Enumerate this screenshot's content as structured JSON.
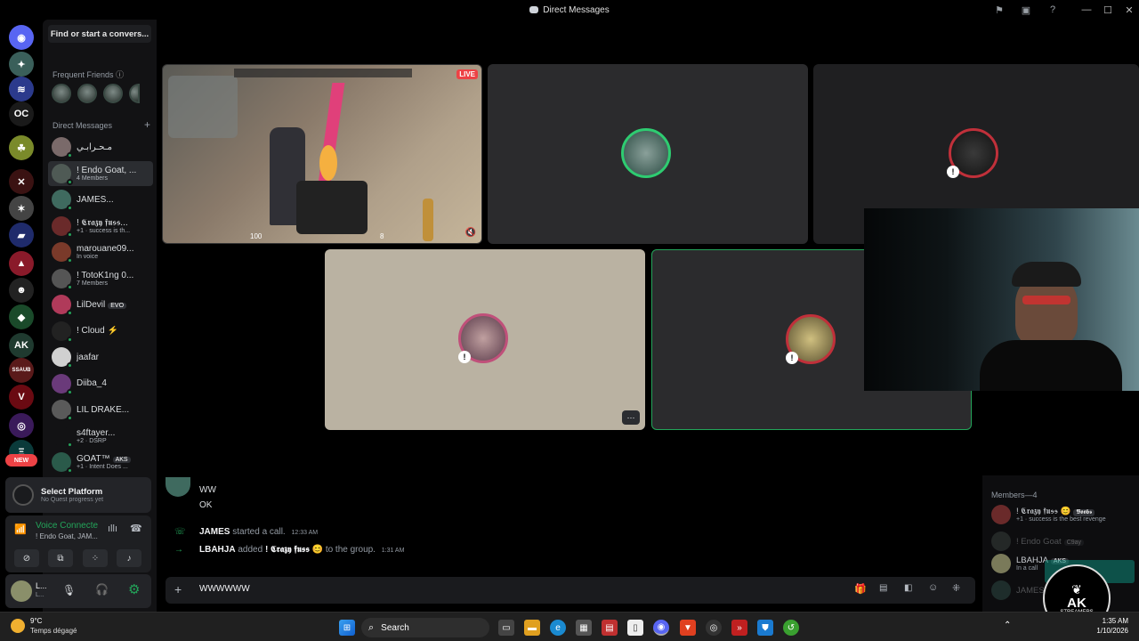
{
  "window": {
    "title": "Direct Messages"
  },
  "guilds": [
    {
      "color": "#5865f2",
      "glyph": "◉",
      "badge": "24"
    },
    {
      "color": "#3a5f5a",
      "glyph": "✦",
      "badge": ""
    },
    {
      "color": "#2b3a8c",
      "glyph": "≋",
      "badge": "1"
    },
    {
      "color": "#1a1a1a",
      "glyph": "OC",
      "badge": "1"
    },
    {
      "color": "#7a8a2a",
      "glyph": "☘",
      "badge": ""
    },
    {
      "color": "#3a1212",
      "glyph": "✕",
      "badge": "65"
    },
    {
      "color": "#444444",
      "glyph": "✶",
      "badge": "1"
    },
    {
      "color": "#1f2b6b",
      "glyph": "▰",
      "badge": "1"
    },
    {
      "color": "#8a1a2a",
      "glyph": "▲",
      "badge": "144"
    },
    {
      "color": "#222222",
      "glyph": "☻",
      "badge": "1"
    },
    {
      "color": "#1a4a2a",
      "glyph": "◆",
      "badge": "837"
    },
    {
      "color": "#1f3a2f",
      "glyph": "AK",
      "badge": "1"
    },
    {
      "color": "#5a1a1a",
      "glyph": "SSAUB",
      "badge": ""
    },
    {
      "color": "#6a0a12",
      "glyph": "V",
      "badge": ""
    },
    {
      "color": "#3a1a5a",
      "glyph": "◎",
      "badge": "88"
    },
    {
      "color": "#0a3a3a",
      "glyph": "Ξ",
      "badge": ""
    }
  ],
  "new_badge": "NEW",
  "sidebar": {
    "search_placeholder": "Find or start a convers...",
    "frequent_friends_label": "Frequent Friends",
    "direct_messages_label": "Direct Messages",
    "add_icon": "+",
    "dms": [
      {
        "name": "مـحـرابـي",
        "sub": "",
        "color": "#7a6a6a"
      },
      {
        "name": "! Endo Goat, ...",
        "sub": "4 Members",
        "color": "#4f5a55"
      },
      {
        "name": "JAMES...",
        "sub": "",
        "color": "#3f6a5f"
      },
      {
        "name": "! 𝕮𝖗𝖆𝖟𝖞 𝖋𝖚𝖘𝖘...",
        "sub": "+1 · success is th...",
        "color": "#6a2a2a"
      },
      {
        "name": "marouane09...",
        "sub": "In voice",
        "color": "#7a3a2a"
      },
      {
        "name": "! TotoK1ng 0...",
        "sub": "7 Members",
        "color": "#555555"
      },
      {
        "name": "LilDevil",
        "sub": "",
        "color": "#b03a5a",
        "tag": "EVO"
      },
      {
        "name": "! Cloud ⚡",
        "sub": "",
        "color": "#222222"
      },
      {
        "name": "jaafar",
        "sub": "",
        "color": "#d0d0d0"
      },
      {
        "name": "Diiba_4",
        "sub": "",
        "color": "#6a3a7a"
      },
      {
        "name": "LIL DRAKE...",
        "sub": "",
        "color": "#5a5a5a"
      },
      {
        "name": "s4ftayer...",
        "sub": "+2 · DSRP",
        "color": "#121214"
      },
      {
        "name": "GOAT™",
        "sub": "+1 · Intent Does ...",
        "color": "#2a5a4a",
        "tag": "AKS"
      }
    ]
  },
  "quest": {
    "title": "Select Platform",
    "subtitle": "No Quest progress yet"
  },
  "voice": {
    "status": "Voice Connecte",
    "channel": "! Endo Goat, JAM..."
  },
  "user": {
    "name": "L...",
    "sub": "L..."
  },
  "tiles": {
    "live_label": "LIVE",
    "stream_hp": "100",
    "stream_ammo": "8"
  },
  "chat": {
    "messages": [
      {
        "author": "JAMES",
        "time": "12:33 AM",
        "lines": [
          "WW",
          "OK"
        ]
      },
      {
        "author": "JAMES",
        "text": "started a call.",
        "time": "12:33 AM"
      },
      {
        "author": "LBAHJA",
        "text_before": "added",
        "target": "! 𝕮𝖗𝖆𝖟𝖞 𝖋𝖚𝖘𝖘 😊",
        "text_after": "to the group.",
        "time": "1:31 AM"
      }
    ],
    "composer_value": "WWWWWW"
  },
  "members": {
    "header": "Members—4",
    "list": [
      {
        "name": "! 𝕮𝖗𝖆𝖟𝖞 𝖋𝖚𝖘𝖘 😊",
        "tag": "𝕭𝖔𝖔𝖇𝖘",
        "sub": "+1 · success is the best revenge",
        "color": "#6a2a2a"
      },
      {
        "name": "! Endo Goat",
        "tag": "C9ay",
        "sub": "",
        "color": "#4f5a55"
      },
      {
        "name": "LBAHJA",
        "tag": "AKS",
        "sub": "In a call",
        "color": "#7a7a5a"
      },
      {
        "name": "JAMES",
        "tag": "",
        "sub": "",
        "color": "#3f6a5f"
      }
    ]
  },
  "taskbar": {
    "weather_temp": "9°C",
    "weather_desc": "Temps dégagé",
    "search_label": "Search",
    "time": "1:35 AM",
    "date": "1/10/2026"
  },
  "overlay": {
    "brand": "AK",
    "brand_sub": "STREAMERS"
  }
}
